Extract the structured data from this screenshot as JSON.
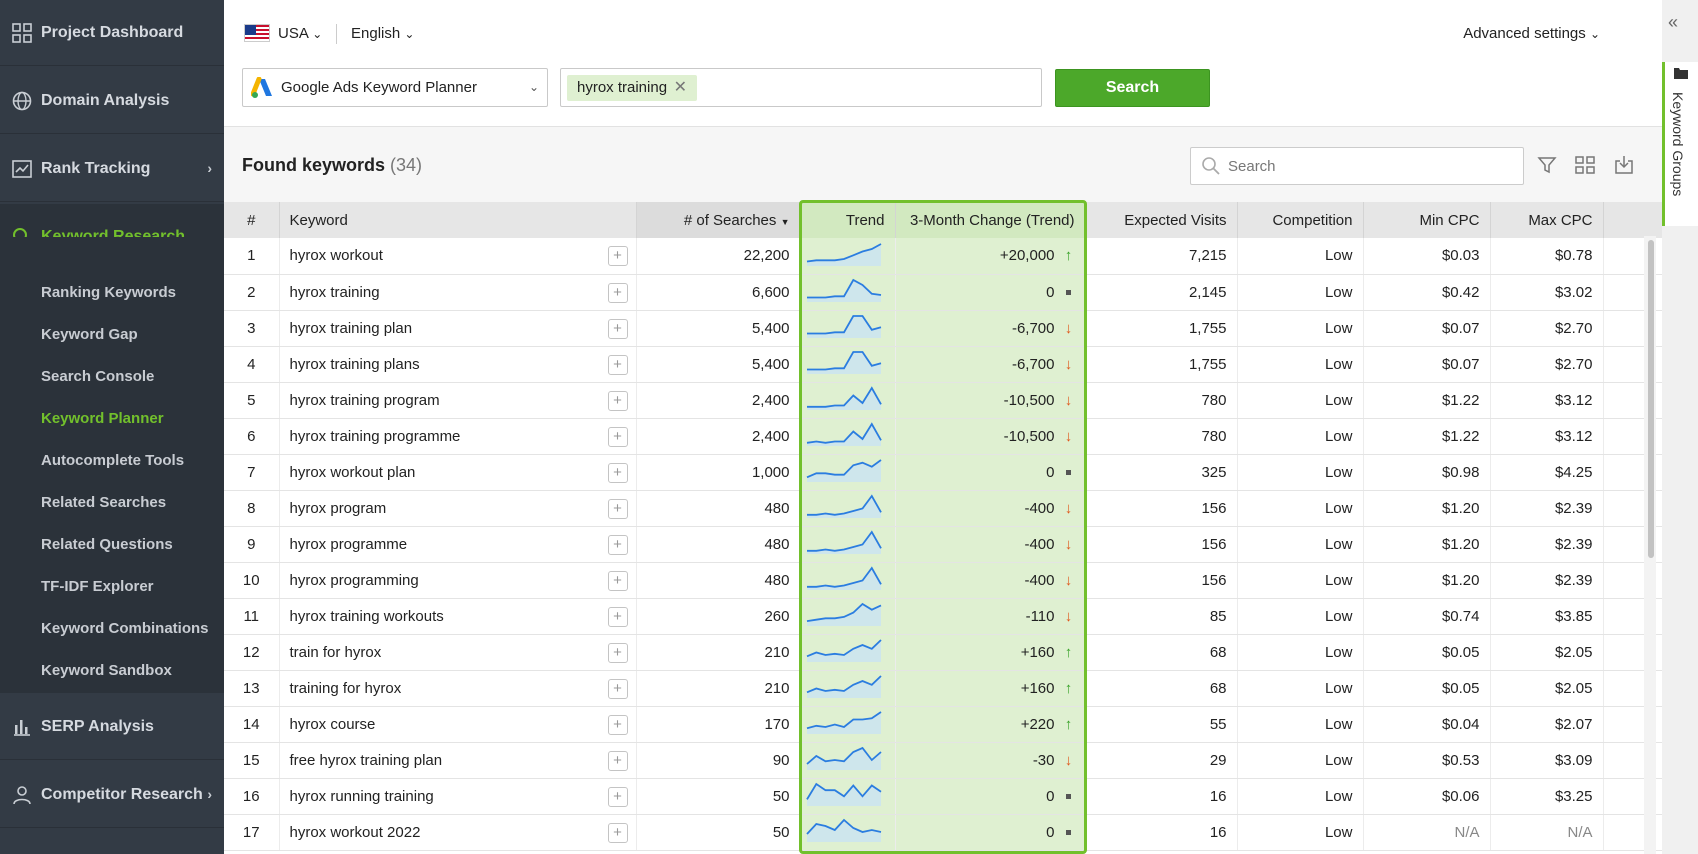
{
  "sidebar": {
    "main": [
      {
        "label": "Project Dashboard",
        "icon": "grid-icon"
      },
      {
        "label": "Domain Analysis",
        "icon": "globe-icon"
      },
      {
        "label": "Rank Tracking",
        "icon": "chart-line-icon"
      },
      {
        "label": "Keyword Research",
        "icon": "search-icon"
      },
      {
        "label": "SERP Analysis",
        "icon": "bar-chart-icon"
      },
      {
        "label": "Competitor Research",
        "icon": "person-icon"
      }
    ],
    "sub": [
      {
        "label": "Ranking Keywords"
      },
      {
        "label": "Keyword Gap"
      },
      {
        "label": "Search Console"
      },
      {
        "label": "Keyword Planner"
      },
      {
        "label": "Autocomplete Tools"
      },
      {
        "label": "Related Searches"
      },
      {
        "label": "Related Questions"
      },
      {
        "label": "TF-IDF Explorer"
      },
      {
        "label": "Keyword Combinations"
      },
      {
        "label": "Keyword Sandbox"
      }
    ],
    "active_color": "#72c02c"
  },
  "topbar": {
    "country": "USA",
    "language": "English",
    "advanced": "Advanced settings",
    "source": "Google Ads Keyword Planner",
    "keyword_tag": "hyrox training",
    "search_button": "Search"
  },
  "results": {
    "title": "Found keywords",
    "count": "(34)",
    "search_placeholder": "Search"
  },
  "table": {
    "headers": {
      "num": "#",
      "keyword": "Keyword",
      "searches": "# of Searches",
      "trend": "Trend",
      "change": "3-Month Change (Trend)",
      "visits": "Expected Visits",
      "competition": "Competition",
      "min_cpc": "Min CPC",
      "max_cpc": "Max CPC"
    },
    "rows": [
      {
        "num": "1",
        "keyword": "hyrox workout",
        "searches": "22,200",
        "change": "+20,000",
        "dir": "up",
        "visits": "7,215",
        "competition": "Low",
        "min_cpc": "$0.03",
        "max_cpc": "$0.78",
        "trend": [
          2,
          3,
          3,
          3,
          4,
          7,
          10,
          12,
          16
        ]
      },
      {
        "num": "2",
        "keyword": "hyrox training",
        "searches": "6,600",
        "change": "0",
        "dir": "flat",
        "visits": "2,145",
        "competition": "Low",
        "min_cpc": "$0.42",
        "max_cpc": "$3.02",
        "trend": [
          2,
          2,
          2,
          3,
          3,
          16,
          12,
          5,
          4
        ]
      },
      {
        "num": "3",
        "keyword": "hyrox training plan",
        "searches": "5,400",
        "change": "-6,700",
        "dir": "down",
        "visits": "1,755",
        "competition": "Low",
        "min_cpc": "$0.07",
        "max_cpc": "$2.70",
        "trend": [
          2,
          2,
          2,
          3,
          3,
          16,
          16,
          5,
          7
        ]
      },
      {
        "num": "4",
        "keyword": "hyrox training plans",
        "searches": "5,400",
        "change": "-6,700",
        "dir": "down",
        "visits": "1,755",
        "competition": "Low",
        "min_cpc": "$0.07",
        "max_cpc": "$2.70",
        "trend": [
          2,
          2,
          2,
          3,
          3,
          16,
          16,
          5,
          7
        ]
      },
      {
        "num": "5",
        "keyword": "hyrox training program",
        "searches": "2,400",
        "change": "-10,500",
        "dir": "down",
        "visits": "780",
        "competition": "Low",
        "min_cpc": "$1.22",
        "max_cpc": "$3.12",
        "trend": [
          1,
          1,
          1,
          2,
          2,
          10,
          4,
          16,
          3
        ]
      },
      {
        "num": "6",
        "keyword": "hyrox training programme",
        "searches": "2,400",
        "change": "-10,500",
        "dir": "down",
        "visits": "780",
        "competition": "Low",
        "min_cpc": "$1.22",
        "max_cpc": "$3.12",
        "trend": [
          1,
          2,
          1,
          2,
          2,
          10,
          4,
          16,
          3
        ]
      },
      {
        "num": "7",
        "keyword": "hyrox workout plan",
        "searches": "1,000",
        "change": "0",
        "dir": "flat",
        "visits": "325",
        "competition": "Low",
        "min_cpc": "$0.98",
        "max_cpc": "$4.25",
        "trend": [
          2,
          5,
          5,
          4,
          4,
          11,
          13,
          10,
          15
        ]
      },
      {
        "num": "8",
        "keyword": "hyrox program",
        "searches": "480",
        "change": "-400",
        "dir": "down",
        "visits": "156",
        "competition": "Low",
        "min_cpc": "$1.20",
        "max_cpc": "$2.39",
        "trend": [
          1,
          1,
          2,
          1,
          2,
          4,
          6,
          16,
          3
        ]
      },
      {
        "num": "9",
        "keyword": "hyrox programme",
        "searches": "480",
        "change": "-400",
        "dir": "down",
        "visits": "156",
        "competition": "Low",
        "min_cpc": "$1.20",
        "max_cpc": "$2.39",
        "trend": [
          1,
          1,
          2,
          1,
          2,
          4,
          6,
          16,
          3
        ]
      },
      {
        "num": "10",
        "keyword": "hyrox programming",
        "searches": "480",
        "change": "-400",
        "dir": "down",
        "visits": "156",
        "competition": "Low",
        "min_cpc": "$1.20",
        "max_cpc": "$2.39",
        "trend": [
          1,
          1,
          2,
          1,
          2,
          4,
          6,
          16,
          3
        ]
      },
      {
        "num": "11",
        "keyword": "hyrox training workouts",
        "searches": "260",
        "change": "-110",
        "dir": "down",
        "visits": "85",
        "competition": "Low",
        "min_cpc": "$0.74",
        "max_cpc": "$3.85",
        "trend": [
          2,
          3,
          4,
          4,
          5,
          8,
          14,
          10,
          13
        ]
      },
      {
        "num": "12",
        "keyword": "train for hyrox",
        "searches": "210",
        "change": "+160",
        "dir": "up",
        "visits": "68",
        "competition": "Low",
        "min_cpc": "$0.05",
        "max_cpc": "$2.05",
        "trend": [
          3,
          6,
          4,
          5,
          4,
          9,
          12,
          9,
          16
        ]
      },
      {
        "num": "13",
        "keyword": "training for hyrox",
        "searches": "210",
        "change": "+160",
        "dir": "up",
        "visits": "68",
        "competition": "Low",
        "min_cpc": "$0.05",
        "max_cpc": "$2.05",
        "trend": [
          3,
          6,
          4,
          5,
          4,
          9,
          12,
          9,
          16
        ]
      },
      {
        "num": "14",
        "keyword": "hyrox course",
        "searches": "170",
        "change": "+220",
        "dir": "up",
        "visits": "55",
        "competition": "Low",
        "min_cpc": "$0.04",
        "max_cpc": "$2.07",
        "trend": [
          3,
          5,
          4,
          6,
          4,
          10,
          10,
          11,
          16
        ]
      },
      {
        "num": "15",
        "keyword": "free hyrox training plan",
        "searches": "90",
        "change": "-30",
        "dir": "down",
        "visits": "29",
        "competition": "Low",
        "min_cpc": "$0.53",
        "max_cpc": "$3.09",
        "trend": [
          3,
          9,
          5,
          6,
          5,
          12,
          15,
          6,
          12
        ]
      },
      {
        "num": "16",
        "keyword": "hyrox running training",
        "searches": "50",
        "change": "0",
        "dir": "flat",
        "visits": "16",
        "competition": "Low",
        "min_cpc": "$0.06",
        "max_cpc": "$3.25",
        "trend": [
          3,
          13,
          9,
          9,
          5,
          12,
          5,
          12,
          8
        ]
      },
      {
        "num": "17",
        "keyword": "hyrox workout 2022",
        "searches": "50",
        "change": "0",
        "dir": "flat",
        "visits": "16",
        "competition": "Low",
        "min_cpc": "N/A",
        "max_cpc": "N/A",
        "trend": [
          3,
          8,
          7,
          5,
          10,
          6,
          4,
          5,
          4
        ]
      }
    ]
  },
  "side_panel": {
    "tab_label": "Keyword Groups"
  },
  "colors": {
    "accent_green": "#72c02c",
    "button_green": "#4ca82a",
    "sidebar_bg": "#333b45",
    "trend_highlight": "#dff0d1",
    "sparkline": "#2b7de0",
    "arrow_up": "#3aa32a",
    "arrow_down": "#e05a1e"
  }
}
